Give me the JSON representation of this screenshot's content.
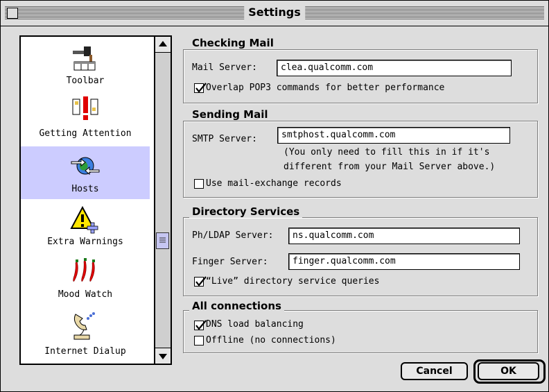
{
  "window": {
    "title": "Settings"
  },
  "sidebar": {
    "items": [
      {
        "label": "Toolbar",
        "icon": "hammer-toolbar-icon"
      },
      {
        "label": "Getting Attention",
        "icon": "exclamation-attention-icon"
      },
      {
        "label": "Hosts",
        "icon": "globe-arrows-icon",
        "selected": true
      },
      {
        "label": "Extra Warnings",
        "icon": "warning-triangle-icon"
      },
      {
        "label": "Mood Watch",
        "icon": "chili-peppers-icon"
      },
      {
        "label": "Internet Dialup",
        "icon": "phone-dialup-icon"
      }
    ]
  },
  "checking_mail": {
    "title": "Checking Mail",
    "mail_server_label": "Mail Server:",
    "mail_server_value": "clea.qualcomm.com",
    "overlap_label": "Overlap POP3 commands for better performance",
    "overlap_checked": true
  },
  "sending_mail": {
    "title": "Sending Mail",
    "smtp_label": "SMTP Server:",
    "smtp_value": "smtphost.qualcomm.com",
    "note_line1": "(You only need to fill this in if it's",
    "note_line2": "different from your Mail Server above.)",
    "mx_label": "Use mail-exchange records",
    "mx_checked": false
  },
  "directory": {
    "title": "Directory Services",
    "ph_label": "Ph/LDAP Server:",
    "ph_value": "ns.qualcomm.com",
    "finger_label": "Finger Server:",
    "finger_value": "finger.qualcomm.com",
    "live_label": "“Live” directory service queries",
    "live_checked": true
  },
  "connections": {
    "title": "All connections",
    "dns_label": "DNS load balancing",
    "dns_checked": true,
    "offline_label": "Offline (no connections)",
    "offline_checked": false
  },
  "buttons": {
    "cancel": "Cancel",
    "ok": "OK"
  }
}
